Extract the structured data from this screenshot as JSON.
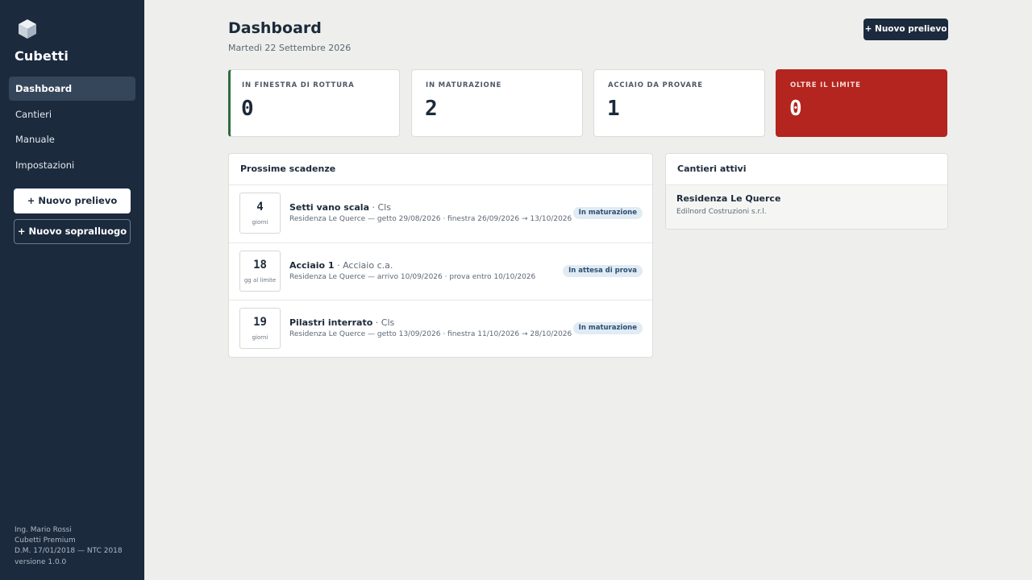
{
  "app": {
    "name": "Cubetti",
    "logo_icon": "cube-icon"
  },
  "sidebar": {
    "items": [
      {
        "label": "Dashboard",
        "active": true
      },
      {
        "label": "Cantieri",
        "active": false
      },
      {
        "label": "Manuale",
        "active": false
      },
      {
        "label": "Impostazioni",
        "active": false
      }
    ],
    "new_sample_label": "+ Nuovo prelievo",
    "new_inspection_label": "+ Nuovo sopralluogo",
    "footer": {
      "user": "Ing. Mario Rossi",
      "plan": "Cubetti Premium",
      "norm": "D.M. 17/01/2018 — NTC 2018",
      "version": "versione 1.0.0"
    }
  },
  "header": {
    "title": "Dashboard",
    "date": "Martedì 22 Settembre 2026",
    "new_sample_label": "+ Nuovo prelievo"
  },
  "stats": [
    {
      "label": "IN FINESTRA DI ROTTURA",
      "value": "0",
      "accent": "#2e6b3f"
    },
    {
      "label": "IN MATURAZIONE",
      "value": "2"
    },
    {
      "label": "ACCIAIO DA PROVARE",
      "value": "1"
    },
    {
      "label": "OLTRE IL LIMITE",
      "value": "0",
      "background": "#b3251e"
    }
  ],
  "deadlines": {
    "title": "Prossime scadenze",
    "rows": [
      {
        "count": "4",
        "unit": "giorni",
        "name": "Setti vano scala",
        "type": "Cls",
        "details": "Residenza Le Querce — getto 29/08/2026 · finestra 26/09/2026 → 13/10/2026",
        "status": "In maturazione"
      },
      {
        "count": "18",
        "unit": "gg al limite",
        "name": "Acciaio 1",
        "type": "Acciaio c.a.",
        "details": "Residenza Le Querce — arrivo 10/09/2026 · prova entro 10/10/2026",
        "status": "In attesa di prova"
      },
      {
        "count": "19",
        "unit": "giorni",
        "name": "Pilastri interrato",
        "type": "Cls",
        "details": "Residenza Le Querce — getto 13/09/2026 · finestra 11/10/2026 → 28/10/2026",
        "status": "In maturazione"
      }
    ]
  },
  "active_sites": {
    "title": "Cantieri attivi",
    "items": [
      {
        "name": "Residenza Le Querce",
        "company": "Edilnord Costruzioni s.r.l."
      }
    ]
  }
}
